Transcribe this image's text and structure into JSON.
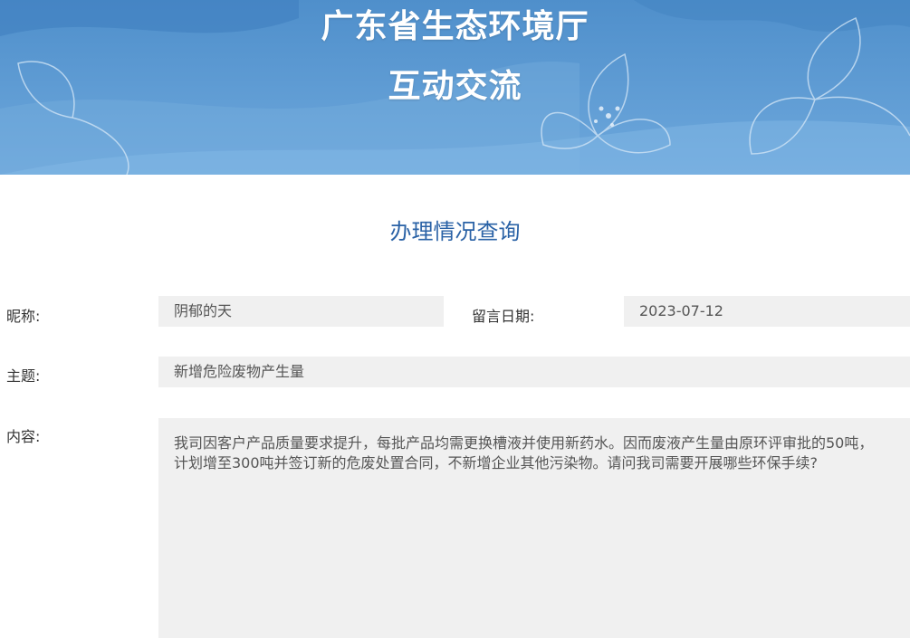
{
  "banner": {
    "title_line1": "广东省生态环境厅",
    "title_line2": "互动交流",
    "color": "#5b98d2"
  },
  "section_title": "办理情况查询",
  "form": {
    "nickname_label": "昵称:",
    "nickname_value": "阴郁的天",
    "date_label": "留言日期:",
    "date_value": "2023-07-12",
    "subject_label": "主题:",
    "subject_value": "新增危险废物产生量",
    "content_label": "内容:",
    "content_value": "我司因客户产品质量要求提升，每批产品均需更换槽液并使用新药水。因而废液产生量由原环评审批的50吨，计划增至300吨并签订新的危废处置合同，不新增企业其他污染物。请问我司需要开展哪些环保手续?"
  },
  "colors": {
    "accent": "#2a62a6",
    "field_bg": "#f0f0f0"
  }
}
